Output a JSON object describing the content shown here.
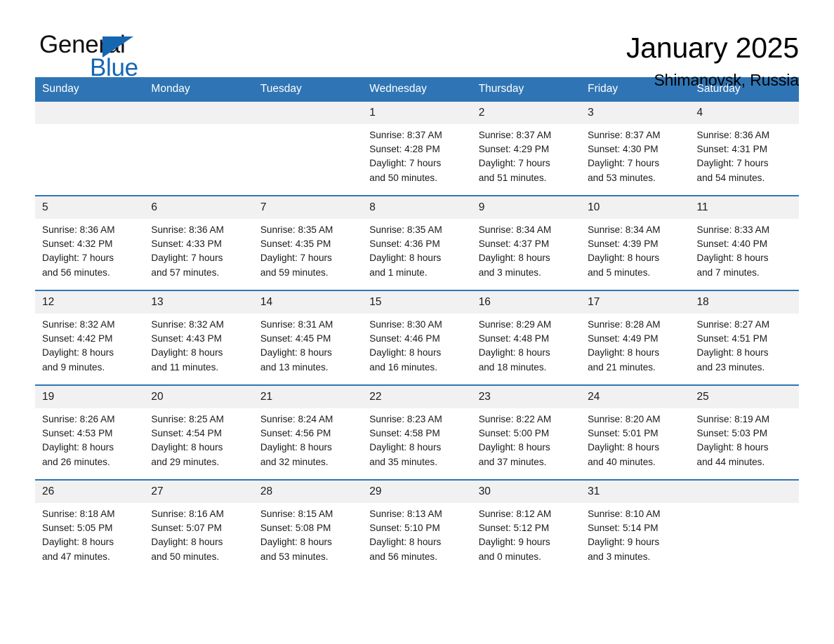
{
  "logo": {
    "word_one": "General",
    "word_two": "Blue",
    "triangle_color": "#1567b2"
  },
  "header": {
    "title": "January 2025",
    "subtitle": "Shimanovsk, Russia"
  },
  "theme": {
    "header_blue": "#2f75b5",
    "daynum_band": "#f1f1f1",
    "text": "#1a1a1a"
  },
  "calendar": {
    "weekday_headers": [
      "Sunday",
      "Monday",
      "Tuesday",
      "Wednesday",
      "Thursday",
      "Friday",
      "Saturday"
    ],
    "weeks": [
      [
        {
          "day": "",
          "lines": []
        },
        {
          "day": "",
          "lines": []
        },
        {
          "day": "",
          "lines": []
        },
        {
          "day": "1",
          "lines": [
            "Sunrise: 8:37 AM",
            "Sunset: 4:28 PM",
            "Daylight: 7 hours",
            "and 50 minutes."
          ]
        },
        {
          "day": "2",
          "lines": [
            "Sunrise: 8:37 AM",
            "Sunset: 4:29 PM",
            "Daylight: 7 hours",
            "and 51 minutes."
          ]
        },
        {
          "day": "3",
          "lines": [
            "Sunrise: 8:37 AM",
            "Sunset: 4:30 PM",
            "Daylight: 7 hours",
            "and 53 minutes."
          ]
        },
        {
          "day": "4",
          "lines": [
            "Sunrise: 8:36 AM",
            "Sunset: 4:31 PM",
            "Daylight: 7 hours",
            "and 54 minutes."
          ]
        }
      ],
      [
        {
          "day": "5",
          "lines": [
            "Sunrise: 8:36 AM",
            "Sunset: 4:32 PM",
            "Daylight: 7 hours",
            "and 56 minutes."
          ]
        },
        {
          "day": "6",
          "lines": [
            "Sunrise: 8:36 AM",
            "Sunset: 4:33 PM",
            "Daylight: 7 hours",
            "and 57 minutes."
          ]
        },
        {
          "day": "7",
          "lines": [
            "Sunrise: 8:35 AM",
            "Sunset: 4:35 PM",
            "Daylight: 7 hours",
            "and 59 minutes."
          ]
        },
        {
          "day": "8",
          "lines": [
            "Sunrise: 8:35 AM",
            "Sunset: 4:36 PM",
            "Daylight: 8 hours",
            "and 1 minute."
          ]
        },
        {
          "day": "9",
          "lines": [
            "Sunrise: 8:34 AM",
            "Sunset: 4:37 PM",
            "Daylight: 8 hours",
            "and 3 minutes."
          ]
        },
        {
          "day": "10",
          "lines": [
            "Sunrise: 8:34 AM",
            "Sunset: 4:39 PM",
            "Daylight: 8 hours",
            "and 5 minutes."
          ]
        },
        {
          "day": "11",
          "lines": [
            "Sunrise: 8:33 AM",
            "Sunset: 4:40 PM",
            "Daylight: 8 hours",
            "and 7 minutes."
          ]
        }
      ],
      [
        {
          "day": "12",
          "lines": [
            "Sunrise: 8:32 AM",
            "Sunset: 4:42 PM",
            "Daylight: 8 hours",
            "and 9 minutes."
          ]
        },
        {
          "day": "13",
          "lines": [
            "Sunrise: 8:32 AM",
            "Sunset: 4:43 PM",
            "Daylight: 8 hours",
            "and 11 minutes."
          ]
        },
        {
          "day": "14",
          "lines": [
            "Sunrise: 8:31 AM",
            "Sunset: 4:45 PM",
            "Daylight: 8 hours",
            "and 13 minutes."
          ]
        },
        {
          "day": "15",
          "lines": [
            "Sunrise: 8:30 AM",
            "Sunset: 4:46 PM",
            "Daylight: 8 hours",
            "and 16 minutes."
          ]
        },
        {
          "day": "16",
          "lines": [
            "Sunrise: 8:29 AM",
            "Sunset: 4:48 PM",
            "Daylight: 8 hours",
            "and 18 minutes."
          ]
        },
        {
          "day": "17",
          "lines": [
            "Sunrise: 8:28 AM",
            "Sunset: 4:49 PM",
            "Daylight: 8 hours",
            "and 21 minutes."
          ]
        },
        {
          "day": "18",
          "lines": [
            "Sunrise: 8:27 AM",
            "Sunset: 4:51 PM",
            "Daylight: 8 hours",
            "and 23 minutes."
          ]
        }
      ],
      [
        {
          "day": "19",
          "lines": [
            "Sunrise: 8:26 AM",
            "Sunset: 4:53 PM",
            "Daylight: 8 hours",
            "and 26 minutes."
          ]
        },
        {
          "day": "20",
          "lines": [
            "Sunrise: 8:25 AM",
            "Sunset: 4:54 PM",
            "Daylight: 8 hours",
            "and 29 minutes."
          ]
        },
        {
          "day": "21",
          "lines": [
            "Sunrise: 8:24 AM",
            "Sunset: 4:56 PM",
            "Daylight: 8 hours",
            "and 32 minutes."
          ]
        },
        {
          "day": "22",
          "lines": [
            "Sunrise: 8:23 AM",
            "Sunset: 4:58 PM",
            "Daylight: 8 hours",
            "and 35 minutes."
          ]
        },
        {
          "day": "23",
          "lines": [
            "Sunrise: 8:22 AM",
            "Sunset: 5:00 PM",
            "Daylight: 8 hours",
            "and 37 minutes."
          ]
        },
        {
          "day": "24",
          "lines": [
            "Sunrise: 8:20 AM",
            "Sunset: 5:01 PM",
            "Daylight: 8 hours",
            "and 40 minutes."
          ]
        },
        {
          "day": "25",
          "lines": [
            "Sunrise: 8:19 AM",
            "Sunset: 5:03 PM",
            "Daylight: 8 hours",
            "and 44 minutes."
          ]
        }
      ],
      [
        {
          "day": "26",
          "lines": [
            "Sunrise: 8:18 AM",
            "Sunset: 5:05 PM",
            "Daylight: 8 hours",
            "and 47 minutes."
          ]
        },
        {
          "day": "27",
          "lines": [
            "Sunrise: 8:16 AM",
            "Sunset: 5:07 PM",
            "Daylight: 8 hours",
            "and 50 minutes."
          ]
        },
        {
          "day": "28",
          "lines": [
            "Sunrise: 8:15 AM",
            "Sunset: 5:08 PM",
            "Daylight: 8 hours",
            "and 53 minutes."
          ]
        },
        {
          "day": "29",
          "lines": [
            "Sunrise: 8:13 AM",
            "Sunset: 5:10 PM",
            "Daylight: 8 hours",
            "and 56 minutes."
          ]
        },
        {
          "day": "30",
          "lines": [
            "Sunrise: 8:12 AM",
            "Sunset: 5:12 PM",
            "Daylight: 9 hours",
            "and 0 minutes."
          ]
        },
        {
          "day": "31",
          "lines": [
            "Sunrise: 8:10 AM",
            "Sunset: 5:14 PM",
            "Daylight: 9 hours",
            "and 3 minutes."
          ]
        },
        {
          "day": "",
          "lines": []
        }
      ]
    ]
  }
}
